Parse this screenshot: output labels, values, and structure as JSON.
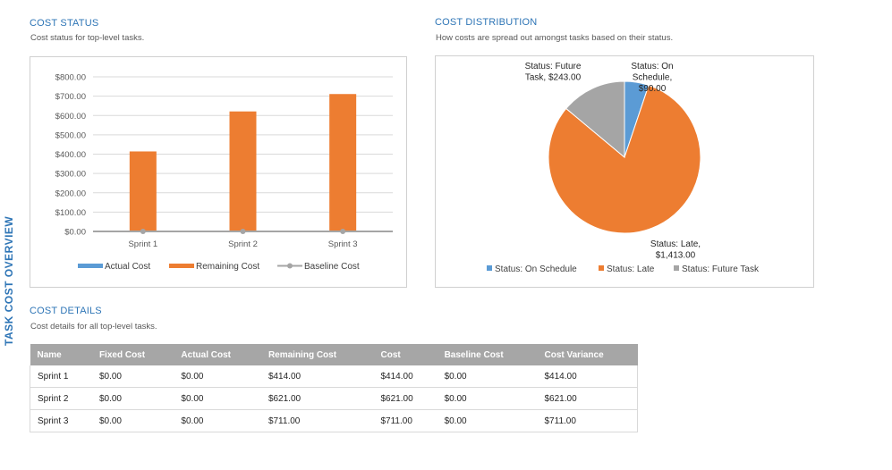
{
  "side_title": "TASK COST OVERVIEW",
  "cost_status": {
    "title": "COST STATUS",
    "subtitle": "Cost status for top-level tasks."
  },
  "cost_distribution": {
    "title": "COST DISTRIBUTION",
    "subtitle": "How costs are spread out amongst tasks based on their status."
  },
  "cost_details": {
    "title": "COST DETAILS",
    "subtitle": "Cost details for all top-level tasks.",
    "columns": [
      "Name",
      "Fixed Cost",
      "Actual Cost",
      "Remaining Cost",
      "Cost",
      "Baseline Cost",
      "Cost Variance"
    ],
    "rows": [
      [
        "Sprint 1",
        "$0.00",
        "$0.00",
        "$414.00",
        "$414.00",
        "$0.00",
        "$414.00"
      ],
      [
        "Sprint 2",
        "$0.00",
        "$0.00",
        "$621.00",
        "$621.00",
        "$0.00",
        "$621.00"
      ],
      [
        "Sprint 3",
        "$0.00",
        "$0.00",
        "$711.00",
        "$711.00",
        "$0.00",
        "$711.00"
      ]
    ]
  },
  "colors": {
    "actual": "#5b9bd5",
    "remaining": "#ed7d31",
    "baseline": "#a5a5a5",
    "future": "#a5a5a5",
    "accent": "#2e75b6"
  },
  "chart_data": [
    {
      "type": "bar",
      "categories": [
        "Sprint 1",
        "Sprint 2",
        "Sprint 3"
      ],
      "series": [
        {
          "name": "Actual Cost",
          "values": [
            0,
            0,
            0
          ]
        },
        {
          "name": "Remaining Cost",
          "values": [
            414,
            621,
            711
          ]
        },
        {
          "name": "Baseline Cost",
          "values": [
            0,
            0,
            0
          ],
          "style": "line"
        }
      ],
      "ylim": [
        0,
        800
      ],
      "yticks": [
        "$0.00",
        "$100.00",
        "$200.00",
        "$300.00",
        "$400.00",
        "$500.00",
        "$600.00",
        "$700.00",
        "$800.00"
      ],
      "grid": true,
      "legend": "bottom"
    },
    {
      "type": "pie",
      "slices": [
        {
          "name": "Status: On Schedule",
          "value": 90,
          "label": [
            "Status: On",
            "Schedule,",
            "$90.00"
          ]
        },
        {
          "name": "Status: Late",
          "value": 1413,
          "label": [
            "Status: Late,",
            "$1,413.00"
          ]
        },
        {
          "name": "Status: Future Task",
          "value": 243,
          "label": [
            "Status: Future",
            "Task, $243.00"
          ]
        }
      ],
      "legend": "bottom"
    }
  ]
}
